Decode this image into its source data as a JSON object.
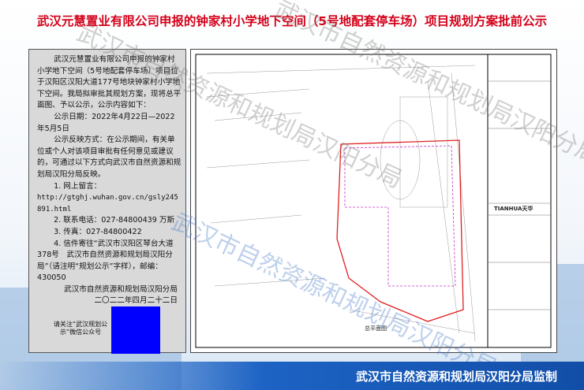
{
  "title": "武汉元慧置业有限公司申报的钟家村小学地下空间（5号地配套停车场）项目规划方案批前公示",
  "notice": {
    "intro": "武汉元慧置业有限公司申报的钟家村小学地下空间（5号地配套停车场）项目位于汉阳区汉阳大道177号地块钟家村小学地下空间。我局拟审批其规划方案，现将总平面图、予以公示，公示内容如下：",
    "period": "公示日期：2022年4月22日—2022年5月5日",
    "feedback": "公示反映方式：在公示期间，有关单位或个人对该项目审批有任何意见或建议的，可通过以下方式向武汉市自然资源和规划局汉阳分局反映。",
    "item1": "1. 网上留言：",
    "url": "http://gtghj.wuhan.gov.cn/gsly245891.html",
    "item2": "2. 联系电话：027-84800439 万斯",
    "item3": "3. 传真：027-84800422",
    "item4": "4. 信件寄往“武汉市汉阳区琴台大道378号　武汉市自然资源和规划局汉阳分局”（请注明“规划公示”字样），邮编：430050",
    "signature": "武汉市自然资源和规划局汉阳分局",
    "date": "二〇二二年四月二十二日",
    "qr_label": "请关注“武汉规划公示”微信公众号"
  },
  "plan": {
    "caption": "总平面图",
    "logo": "TIANHUA天华"
  },
  "watermark": "武汉市自然资源和规划局汉阳分局",
  "footer": "武汉市自然资源和规划局汉阳分局监制"
}
